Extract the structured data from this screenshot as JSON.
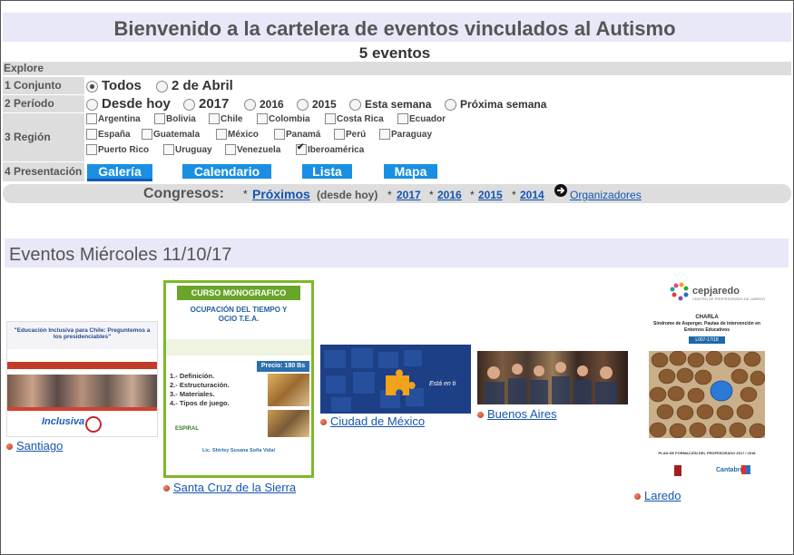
{
  "header": {
    "title": "Bienvenido a la cartelera de eventos vinculados al Autismo",
    "count": "5 eventos"
  },
  "explore": {
    "label": "Explore"
  },
  "conjunto": {
    "label": "1 Conjunto",
    "options": [
      "Todos",
      "2 de Abril"
    ],
    "selected": "Todos"
  },
  "periodo": {
    "label": "2 Período",
    "options": [
      "Desde hoy",
      "2017",
      "2016",
      "2015",
      "Esta semana",
      "Próxima semana"
    ],
    "selected": "Desde hoy"
  },
  "region": {
    "label": "3 Región",
    "options": [
      "Argentina",
      "Bolivia",
      "Chile",
      "Colombia",
      "Costa Rica",
      "Ecuador",
      "España",
      "Guatemala",
      "México",
      "Panamá",
      "Perú",
      "Paraguay",
      "Puerto Rico",
      "Uruguay",
      "Venezuela",
      "Iberoamérica"
    ],
    "checked": [
      "Iberoamérica"
    ]
  },
  "presentacion": {
    "label": "4 Presentación",
    "buttons": [
      "Galería",
      "Calendario",
      "Lista",
      "Mapa"
    ],
    "selected": "Galería"
  },
  "congresos": {
    "label": "Congresos:",
    "star": "*",
    "proximos": "Próximos",
    "desde_hoy": "(desde hoy)",
    "years": [
      "2017",
      "2016",
      "2015",
      "2014"
    ],
    "organizadores": "Organizadores"
  },
  "events": {
    "heading": "Eventos Miércoles 11/10/17",
    "items": [
      {
        "city": "Santiago",
        "poster_title": "\"Educación Inclusiva para Chile: Preguntemos a los presidenciables\"",
        "poster_brand": "Inclusiva"
      },
      {
        "city": "Santa Cruz de la Sierra",
        "poster_title": "CURSO MONOGRAFICO",
        "poster_subtitle": "OCUPACIÓN DEL TIEMPO Y OCIO T.E.A.",
        "poster_price": "Precio: 180 Bs",
        "poster_list": [
          "1.- Definición.",
          "2.- Estructuración.",
          "3.- Materiales.",
          "4.- Tipos de juego."
        ],
        "poster_brand": "ESPIRAL",
        "poster_author": "Lic. Shirley Susana Soña Vidal"
      },
      {
        "city": "Ciudad de México",
        "poster_text": "Está en ti"
      },
      {
        "city": "Buenos Aires"
      },
      {
        "city": "Laredo",
        "poster_brand": "cepjaredo",
        "poster_sub": "CENTRO DE PROFESORADO DE LAREDO",
        "poster_title": "CHARLA",
        "poster_subtitle": "Síndrome de Asperger. Pautas de intervención en Entornos Educativos",
        "poster_code": "L007-17/18",
        "poster_footer": "PLAN DE FORMACIÓN DEL PROFESORADO 2017 / 2018",
        "poster_logo": "Cantabria"
      }
    ]
  },
  "colors": {
    "accent": "#1a8fe3",
    "link": "#1555b0",
    "header_bg": "#e8e8f8",
    "row_bg": "#dddddd"
  }
}
